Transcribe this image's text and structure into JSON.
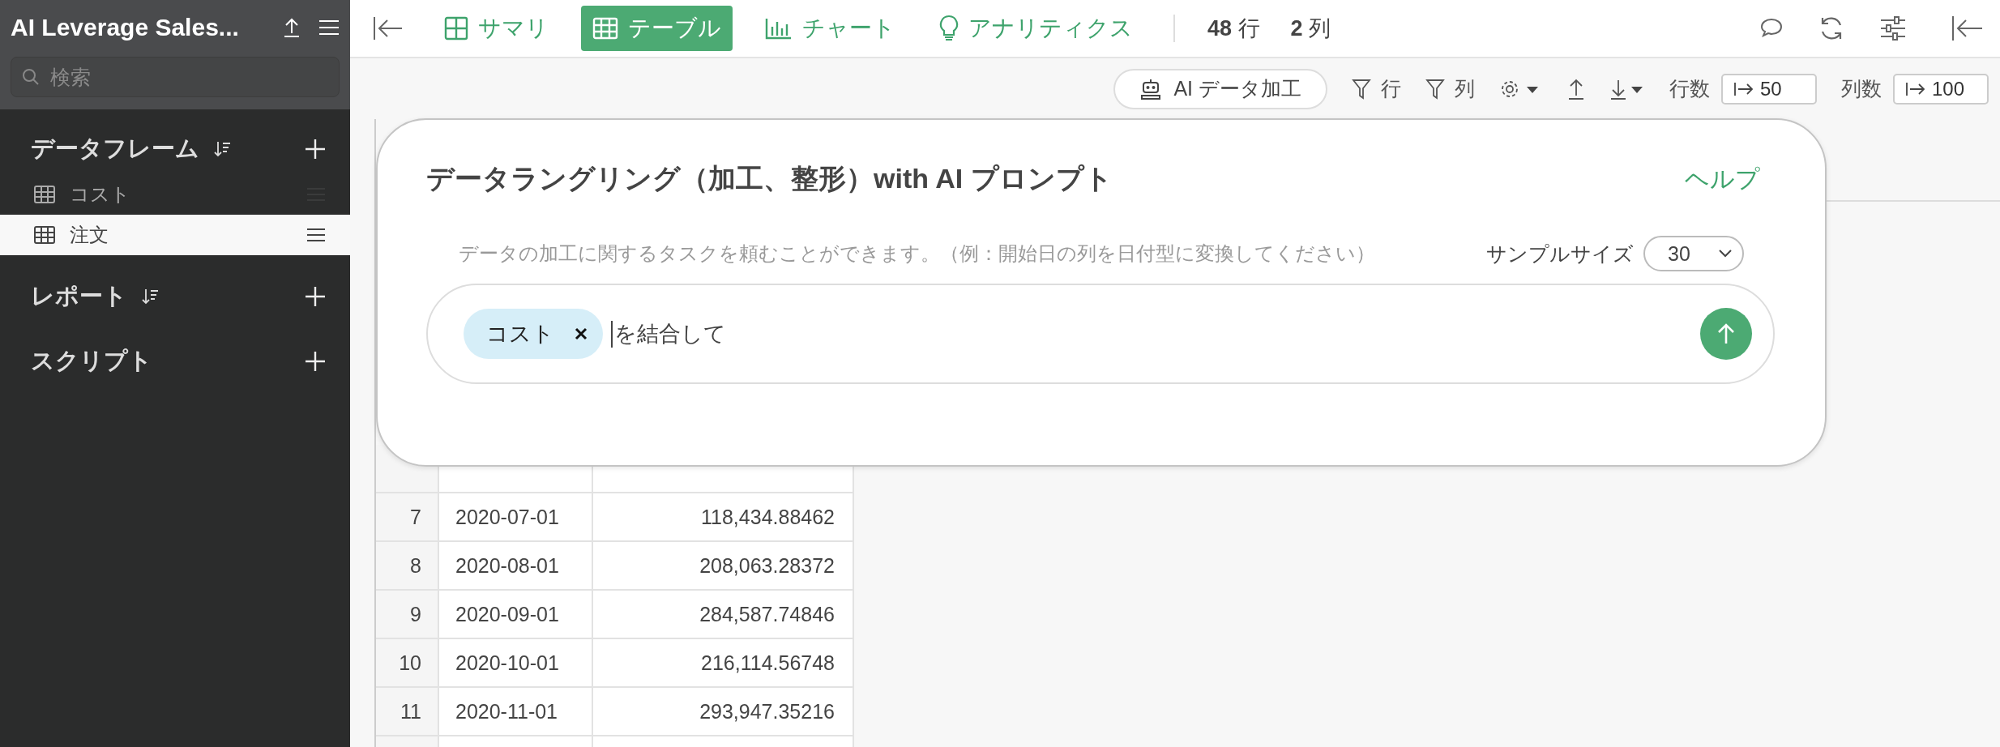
{
  "sidebar": {
    "project_title": "AI Leverage Sales...",
    "search": {
      "placeholder": "検索"
    },
    "sections": [
      {
        "label": "データフレーム",
        "sortable": true,
        "items": [
          {
            "name": "コスト",
            "selected": false
          },
          {
            "name": "注文",
            "selected": true
          }
        ]
      },
      {
        "label": "レポート",
        "sortable": true
      },
      {
        "label": "スクリプト"
      }
    ]
  },
  "view_tabs": [
    {
      "label": "サマリ",
      "kind": "summary",
      "selected": false
    },
    {
      "label": "テーブル",
      "kind": "table",
      "selected": true
    },
    {
      "label": "チャート",
      "kind": "chart",
      "selected": false
    },
    {
      "label": "アナリティクス",
      "kind": "analytics",
      "selected": false
    }
  ],
  "counts": [
    {
      "value": "48",
      "unit": "行"
    },
    {
      "value": "2",
      "unit": "列"
    }
  ],
  "toolbar": {
    "ai_button": "AI データ加工",
    "row_filter": "行",
    "column_filter": "列",
    "row_limit": {
      "label": "行数",
      "value": "50"
    },
    "column_limit": {
      "label": "列数",
      "value": "100"
    }
  },
  "dialog": {
    "title": "データラングリング（加工、整形）with AI プロンプト",
    "help_link": "ヘルプ",
    "description": "データの加工に関するタスクを頼むことができます。（例：開始日の列を日付型に変換してください）",
    "sample_size": {
      "label": "サンプルサイズ",
      "value": "30"
    },
    "prompt": {
      "chips": [
        "コスト"
      ],
      "value": "を結合して"
    }
  },
  "table": {
    "rows": [
      {
        "index": "7",
        "date": "2020-07-01",
        "value": "118,434.88462"
      },
      {
        "index": "8",
        "date": "2020-08-01",
        "value": "208,063.28372"
      },
      {
        "index": "9",
        "date": "2020-09-01",
        "value": "284,587.74846"
      },
      {
        "index": "10",
        "date": "2020-10-01",
        "value": "216,114.56748"
      },
      {
        "index": "11",
        "date": "2020-11-01",
        "value": "293,947.35216"
      }
    ]
  }
}
